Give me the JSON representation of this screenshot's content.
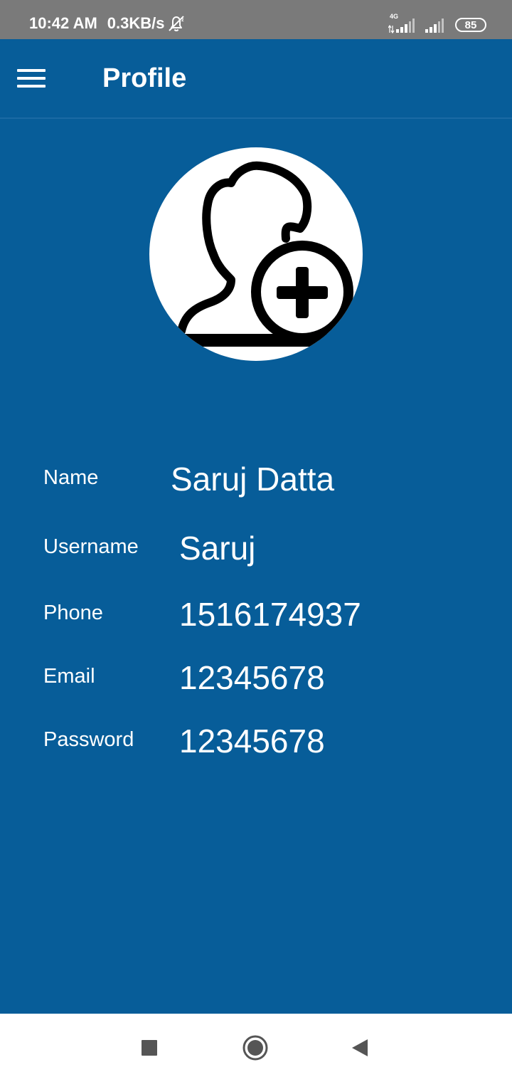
{
  "status_bar": {
    "time": "10:42 AM",
    "net_speed": "0.3KB/s",
    "network_type": "4G",
    "battery": "85",
    "icons": [
      "alarm-off-icon",
      "signal-4g-icon",
      "signal-icon",
      "battery-icon"
    ]
  },
  "app_bar": {
    "title": "Profile",
    "menu_icon": "hamburger-menu-icon"
  },
  "avatar": {
    "icon": "add-user-icon"
  },
  "profile": {
    "fields": [
      {
        "label": "Name",
        "value": "Saruj Datta"
      },
      {
        "label": "Username",
        "value": "Saruj"
      },
      {
        "label": "Phone",
        "value": "1516174937"
      },
      {
        "label": "Email",
        "value": "12345678"
      },
      {
        "label": "Password",
        "value": "12345678"
      }
    ]
  },
  "nav_bar": {
    "icons": [
      "recents-square-icon",
      "home-circle-icon",
      "back-triangle-icon"
    ]
  },
  "colors": {
    "primary": "#075d99",
    "status_bar": "#7a7a7a",
    "nav_bar": "#ffffff",
    "text": "#ffffff"
  }
}
